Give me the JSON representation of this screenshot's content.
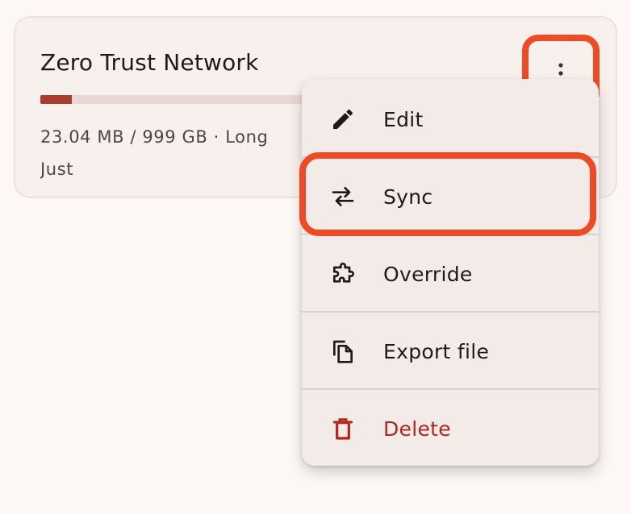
{
  "card": {
    "title": "Zero Trust Network",
    "usage_fraction": 0.12,
    "meta_line1": "23.04 MB / 999 GB · Long",
    "meta_line2": "Just"
  },
  "more_button": {
    "icon": "more-vert-icon"
  },
  "menu": {
    "items": [
      {
        "label": "Edit",
        "icon": "pencil-icon"
      },
      {
        "label": "Sync",
        "icon": "swap-arrows-icon"
      },
      {
        "label": "Override",
        "icon": "puzzle-icon"
      },
      {
        "label": "Export file",
        "icon": "copy-file-icon"
      },
      {
        "label": "Delete",
        "icon": "trash-icon"
      }
    ]
  },
  "colors": {
    "highlight": "#ef4a23",
    "danger": "#b3261e",
    "progress": "#a93d2d"
  }
}
